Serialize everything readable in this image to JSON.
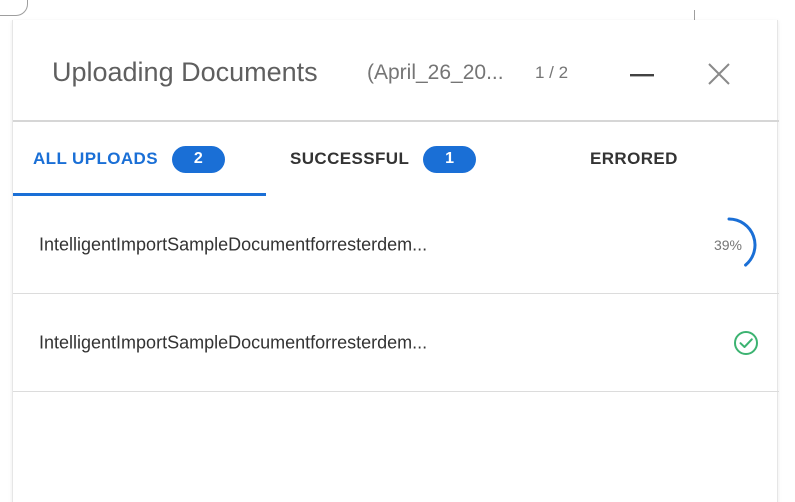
{
  "dialog": {
    "title": "Uploading Documents",
    "subtitle": "(April_26_20...",
    "counter": "1 / 2"
  },
  "tabs": [
    {
      "label": "ALL UPLOADS",
      "count": "2",
      "active": true
    },
    {
      "label": "SUCCESSFUL",
      "count": "1",
      "active": false
    },
    {
      "label": "ERRORED",
      "active": false
    }
  ],
  "uploads": [
    {
      "filename": "IntelligentImportSampleDocumentforresterdem...",
      "status": "uploading",
      "progress_label": "39%",
      "progress": 0.39
    },
    {
      "filename": "IntelligentImportSampleDocumentforresterdem...",
      "status": "success"
    }
  ],
  "icons": {
    "minimize": "minimize-icon",
    "close": "close-icon",
    "success": "check-circle-icon"
  },
  "colors": {
    "accent": "#1a6fd6",
    "success": "#3cb371"
  }
}
